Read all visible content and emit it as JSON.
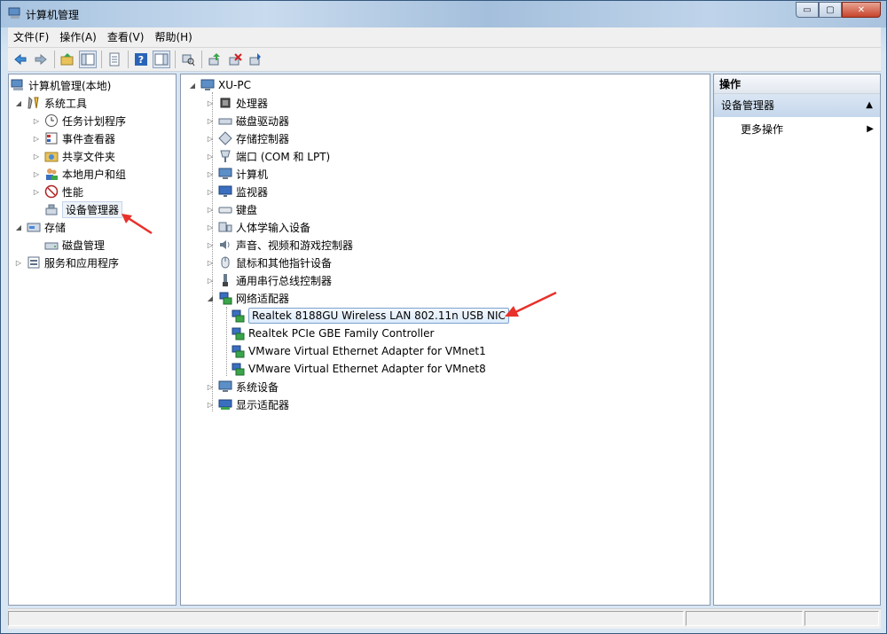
{
  "window": {
    "title": "计算机管理",
    "minimize": "▭",
    "maximize": "▢",
    "close": "✕"
  },
  "menu": [
    "文件(F)",
    "操作(A)",
    "查看(V)",
    "帮助(H)"
  ],
  "left_tree": {
    "root": "计算机管理(本地)",
    "system_tools": "系统工具",
    "items": [
      "任务计划程序",
      "事件查看器",
      "共享文件夹",
      "本地用户和组",
      "性能",
      "设备管理器"
    ],
    "storage": "存储",
    "disk_management": "磁盘管理",
    "services": "服务和应用程序"
  },
  "device_tree": {
    "root": "XU-PC",
    "categories": [
      "处理器",
      "磁盘驱动器",
      "存储控制器",
      "端口 (COM 和 LPT)",
      "计算机",
      "监视器",
      "键盘",
      "人体学输入设备",
      "声音、视频和游戏控制器",
      "鼠标和其他指针设备",
      "通用串行总线控制器",
      "网络适配器"
    ],
    "network_adapters": [
      "Realtek 8188GU Wireless LAN 802.11n USB NIC",
      "Realtek PCIe GBE Family Controller",
      "VMware Virtual Ethernet Adapter for VMnet1",
      "VMware Virtual Ethernet Adapter for VMnet8"
    ],
    "after": [
      "系统设备",
      "显示适配器"
    ]
  },
  "actions": {
    "header": "操作",
    "section": "设备管理器",
    "more": "更多操作"
  },
  "colors": {
    "accent_arrow": "#e8312a",
    "selection": "#dcebfc"
  }
}
